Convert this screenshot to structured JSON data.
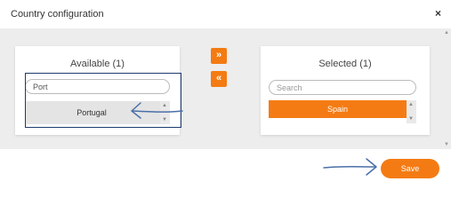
{
  "dialog": {
    "title": "Country configuration",
    "close_label": "×"
  },
  "available": {
    "heading": "Available (1)",
    "search_value": "Port",
    "search_placeholder": "Search",
    "items": [
      "Portugal"
    ]
  },
  "selected": {
    "heading": "Selected (1)",
    "search_value": "",
    "search_placeholder": "Search",
    "items": [
      "Spain"
    ]
  },
  "controls": {
    "add_label": "»",
    "remove_label": "«"
  },
  "footer": {
    "save_label": "Save"
  },
  "colors": {
    "accent": "#f47b13",
    "annotation": "#1e3a6e"
  },
  "icons": {
    "close": "close-icon",
    "scroll_up": "caret-up-icon",
    "scroll_down": "caret-down-icon",
    "annotation_arrow": "arrow-annotation-icon"
  }
}
